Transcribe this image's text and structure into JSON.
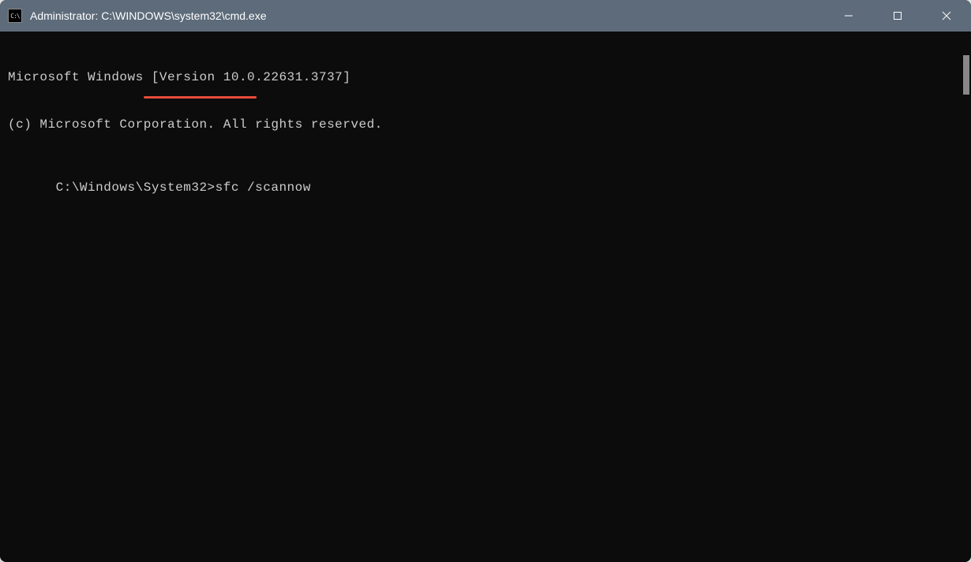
{
  "titlebar": {
    "icon_label": "C:\\",
    "title": "Administrator: C:\\WINDOWS\\system32\\cmd.exe"
  },
  "window_controls": {
    "minimize": "Minimize",
    "maximize": "Maximize",
    "close": "Close"
  },
  "terminal": {
    "lines": [
      "Microsoft Windows [Version 10.0.22631.3737]",
      "(c) Microsoft Corporation. All rights reserved.",
      "",
      ""
    ],
    "prompt": "C:\\Windows\\System32>",
    "command": "sfc /scannow"
  },
  "annotation": {
    "underline_color": "#e74c3c"
  }
}
